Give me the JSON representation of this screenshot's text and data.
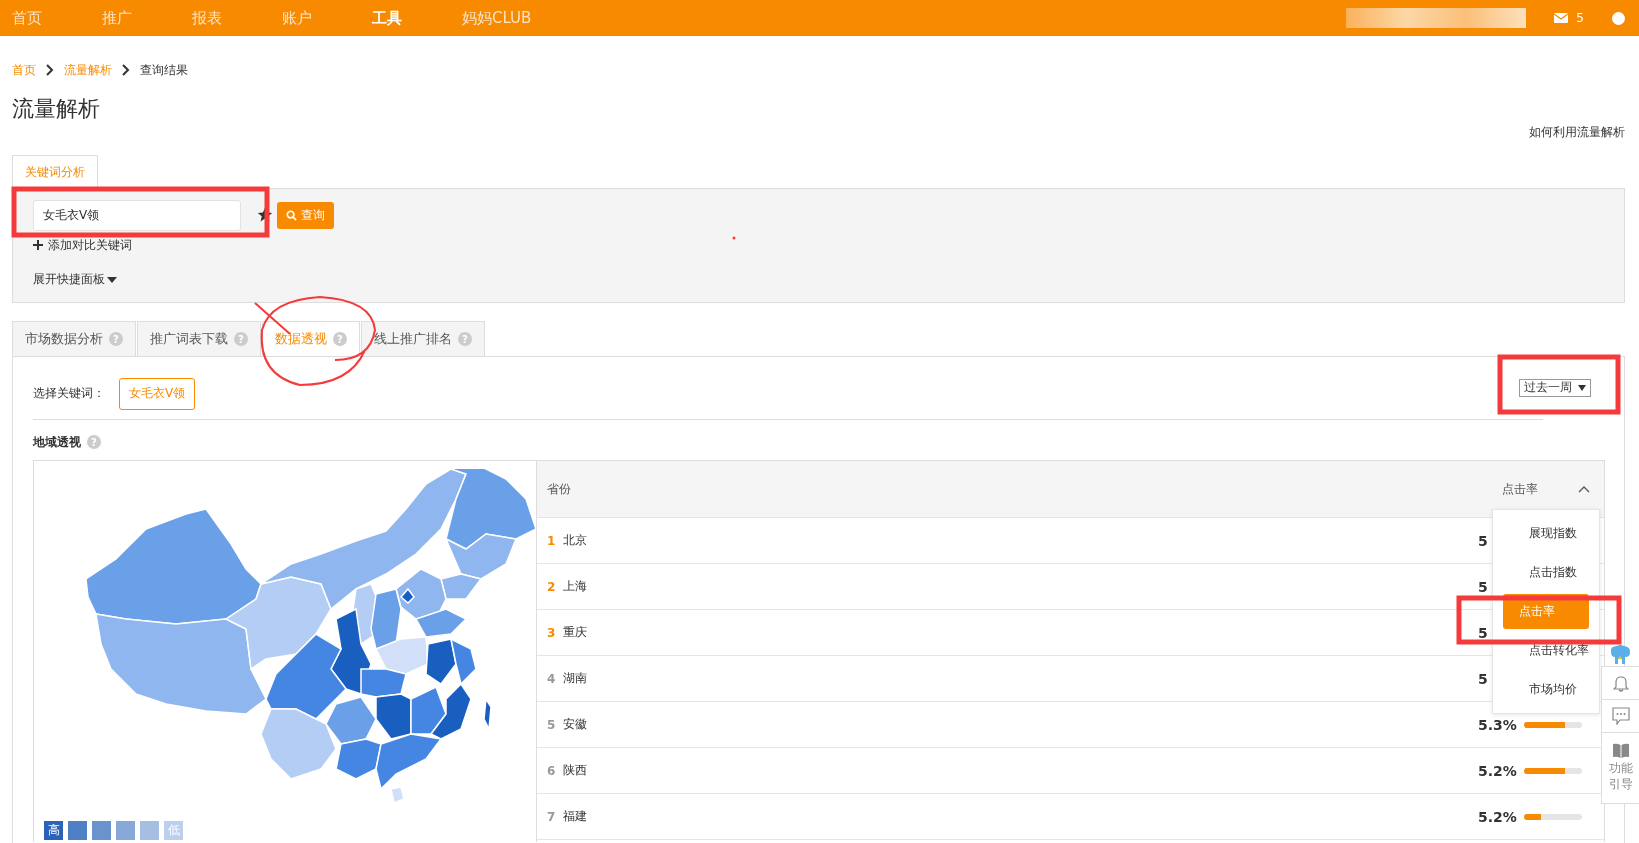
{
  "nav": {
    "items": [
      {
        "label": "首页",
        "selected": false
      },
      {
        "label": "推广",
        "selected": false
      },
      {
        "label": "报表",
        "selected": false
      },
      {
        "label": "账户",
        "selected": false
      },
      {
        "label": "工具",
        "selected": true
      },
      {
        "label": "妈妈CLUB",
        "selected": false
      }
    ],
    "mail_count": "5"
  },
  "breadcrumb": [
    {
      "label": "首页",
      "kind": "link"
    },
    {
      "label": "流量解析",
      "kind": "link"
    },
    {
      "label": "查询结果",
      "kind": "current"
    }
  ],
  "page_title": "流量解析",
  "help_link": "如何利用流量解析",
  "search_tabs": [
    {
      "label": "关键词分析",
      "selected": true
    }
  ],
  "search": {
    "value": "女毛衣V领",
    "button": "查询",
    "add_compare": "添加对比关键词",
    "expand_panel": "展开快捷面板"
  },
  "tabs": [
    {
      "label": "市场数据分析",
      "help": "?",
      "selected": false
    },
    {
      "label": "推广词表下载",
      "help": "?",
      "selected": false
    },
    {
      "label": "数据透视",
      "help": "?",
      "selected": true
    },
    {
      "label": "线上推广排名",
      "help": "?",
      "selected": false
    }
  ],
  "keyword_label": "选择关键词：",
  "keyword_chip": "女毛衣V领",
  "period": "过去一周",
  "section_title": "地域透视",
  "section_help": "?",
  "legend": {
    "high": "高",
    "low": "低"
  },
  "table": {
    "columns": [
      "省份",
      "点击率"
    ],
    "rows": [
      {
        "rank": "1",
        "top": true,
        "province": "北京",
        "value": "5"
      },
      {
        "rank": "2",
        "top": true,
        "province": "上海",
        "value": "5"
      },
      {
        "rank": "3",
        "top": true,
        "province": "重庆",
        "value": "5"
      },
      {
        "rank": "4",
        "top": false,
        "province": "湖南",
        "value": "5"
      },
      {
        "rank": "5",
        "top": false,
        "province": "安徽",
        "value": "5.3%",
        "level": 0.7
      },
      {
        "rank": "6",
        "top": false,
        "province": "陕西",
        "value": "5.2%",
        "level": 0.7
      },
      {
        "rank": "7",
        "top": false,
        "province": "福建",
        "value": "5.2%",
        "level": 0.3
      }
    ]
  },
  "metric_menu": {
    "items": [
      {
        "label": "展现指数",
        "selected": false
      },
      {
        "label": "点击指数",
        "selected": false
      },
      {
        "label": "点击率",
        "selected": true
      },
      {
        "label": "点击转化率",
        "selected": false
      },
      {
        "label": "市场均价",
        "selected": false
      }
    ]
  },
  "side_tools": {
    "guide": "功能引导"
  }
}
